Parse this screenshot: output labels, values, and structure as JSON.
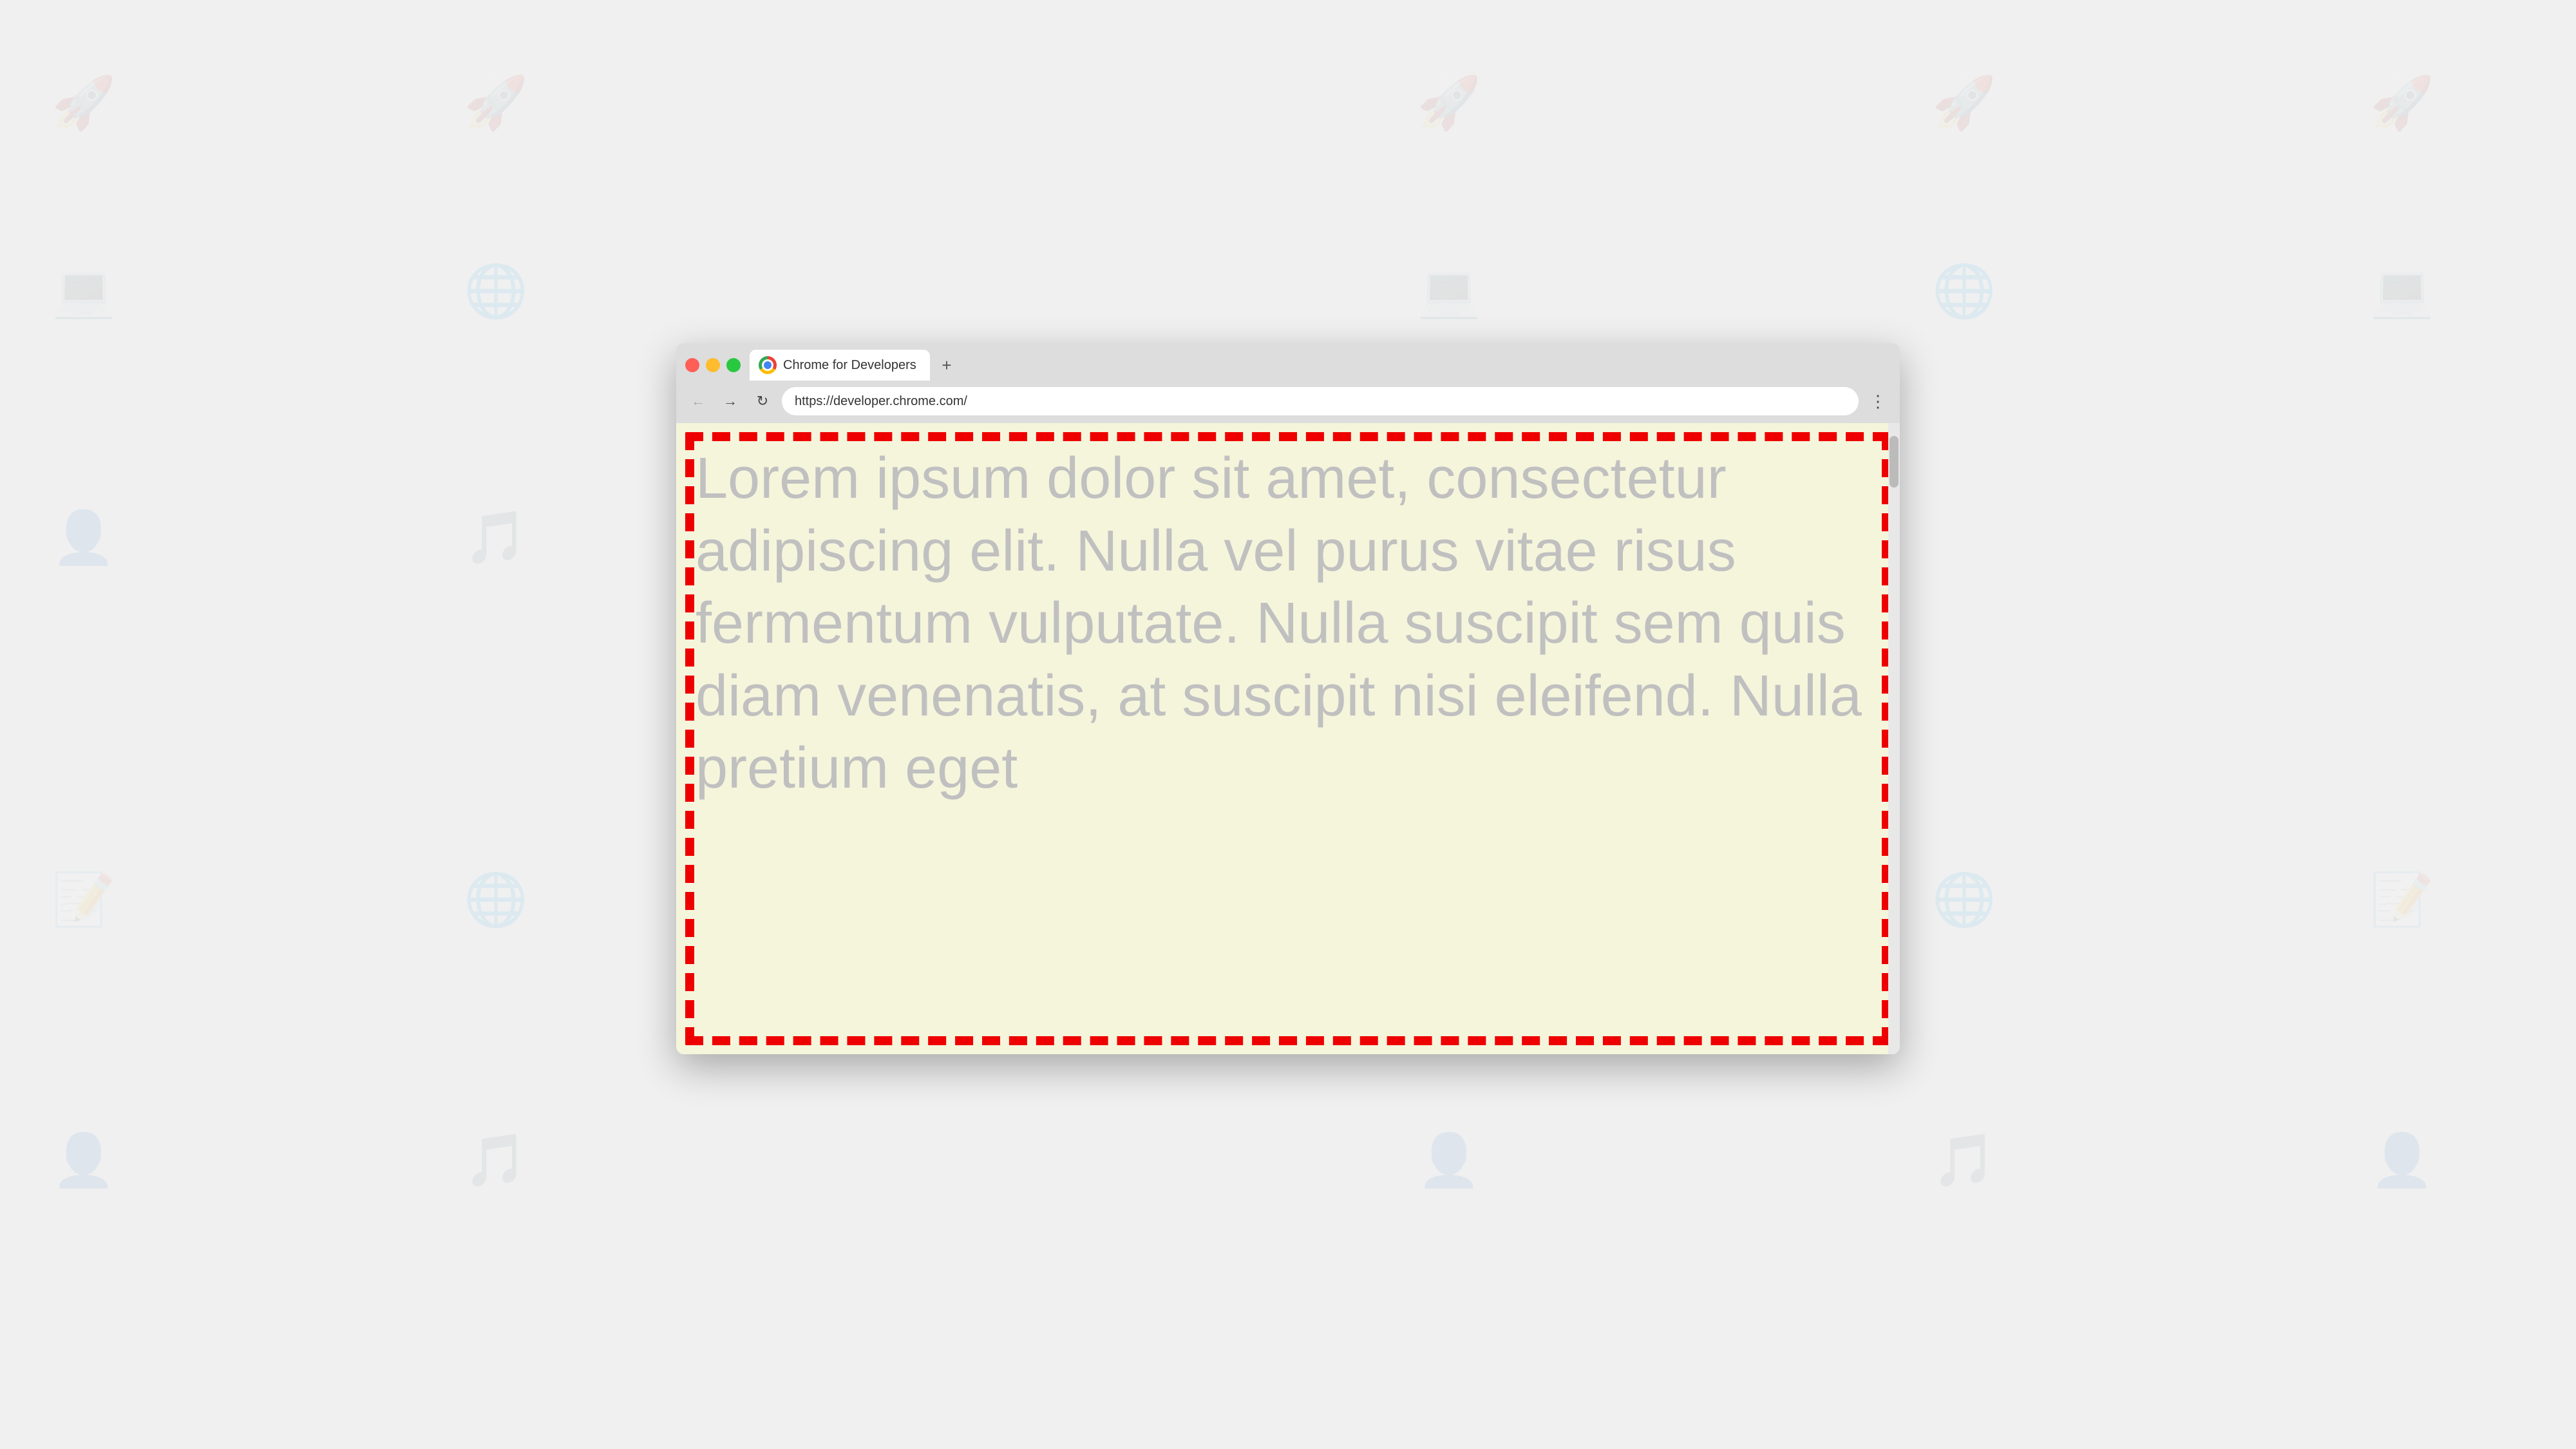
{
  "background": {
    "color": "#f0f0f0"
  },
  "browser": {
    "controls": {
      "close_label": "",
      "minimize_label": "",
      "maximize_label": ""
    },
    "tab": {
      "title": "Chrome for Developers",
      "favicon_alt": "Chrome logo"
    },
    "new_tab_label": "+",
    "nav": {
      "back_icon": "←",
      "forward_icon": "→",
      "refresh_icon": "↻"
    },
    "address_bar": {
      "url": "https://developer.chrome.com/"
    },
    "menu_icon": "⋮",
    "page": {
      "background_color": "#f5f5dc",
      "border_color": "#dd0000",
      "lorem_text": "Lorem ipsum dolor sit amet, consectetur adipiscing elit. Nulla vel purus vitae risus fermentum vulputate. Nulla suscipit sem quis diam venenatis, at suscipit nisi eleifend. Nulla pretium eget",
      "text_color": "#c8c8c8"
    }
  }
}
